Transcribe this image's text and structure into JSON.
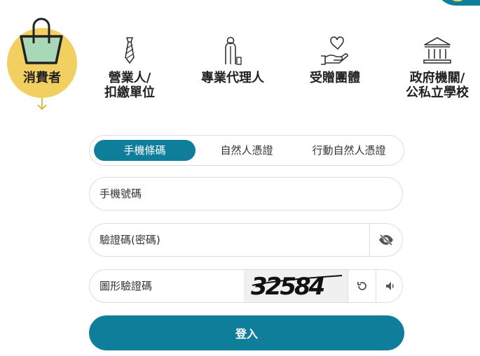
{
  "colors": {
    "accent": "#0f7e9b",
    "active_circle": "#f1d061",
    "border": "#d9dde1"
  },
  "roles": [
    {
      "label": "消費者",
      "icon": "shopping-bag-icon"
    },
    {
      "label_line1": "營業人/",
      "label_line2": "扣繳單位",
      "icon": "necktie-icon"
    },
    {
      "label": "專業代理人",
      "icon": "businessman-icon"
    },
    {
      "label": "受贈團體",
      "icon": "heart-hand-icon"
    },
    {
      "label_line1": "政府機關/",
      "label_line2": "公私立學校",
      "icon": "government-building-icon"
    }
  ],
  "login_tabs": [
    {
      "label": "手機條碼",
      "active": true
    },
    {
      "label": "自然人憑證",
      "active": false
    },
    {
      "label": "行動自然人憑證",
      "active": false
    }
  ],
  "fields": {
    "phone": {
      "placeholder": "手機號碼",
      "value": ""
    },
    "password": {
      "placeholder": "驗證碼(密碼)",
      "value": ""
    },
    "captcha": {
      "placeholder": "圖形驗證碼",
      "value": "",
      "image_text": "32584"
    }
  },
  "login_button": "登入"
}
